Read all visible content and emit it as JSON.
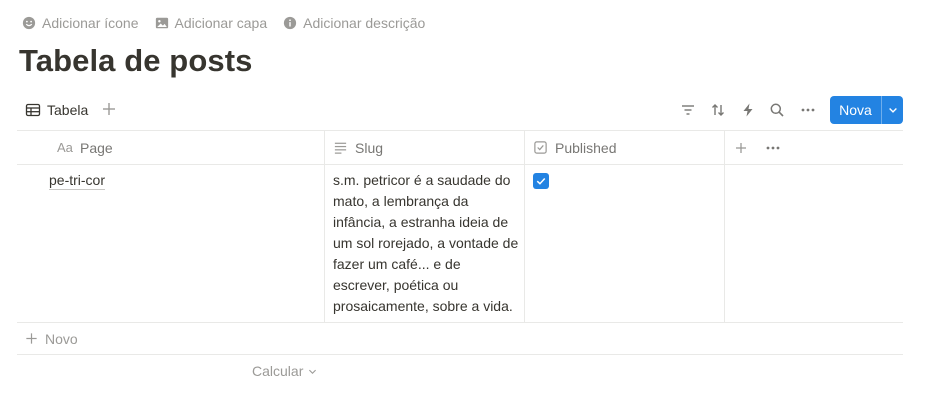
{
  "top_actions": {
    "add_icon": "Adicionar ícone",
    "add_cover": "Adicionar capa",
    "add_description": "Adicionar descrição"
  },
  "page": {
    "title": "Tabela de posts"
  },
  "view": {
    "tab_label": "Tabela",
    "new_button_label": "Nova",
    "toolbar_icons": [
      "filter-icon",
      "sort-icon",
      "automation-icon",
      "search-icon",
      "more-icon"
    ]
  },
  "table": {
    "columns": [
      {
        "label": "Page",
        "icon": "title-aa-icon"
      },
      {
        "label": "Slug",
        "icon": "text-lines-icon"
      },
      {
        "label": "Published",
        "icon": "checkbox-icon"
      }
    ],
    "rows": [
      {
        "page": "pe-tri-cor",
        "slug": "s.m. petricor é a saudade do mato, a lembrança da infância, a estranha ideia de um sol rorejado, a vontade de fazer um café... e de escrever, poética ou prosaicamente, sobre a vida.",
        "published": true
      }
    ],
    "new_row_label": "Novo",
    "calculate_label": "Calcular"
  },
  "colors": {
    "accent": "#2383e2",
    "text": "#37352f",
    "muted": "#9b9a97",
    "border": "#e9e9e7"
  }
}
